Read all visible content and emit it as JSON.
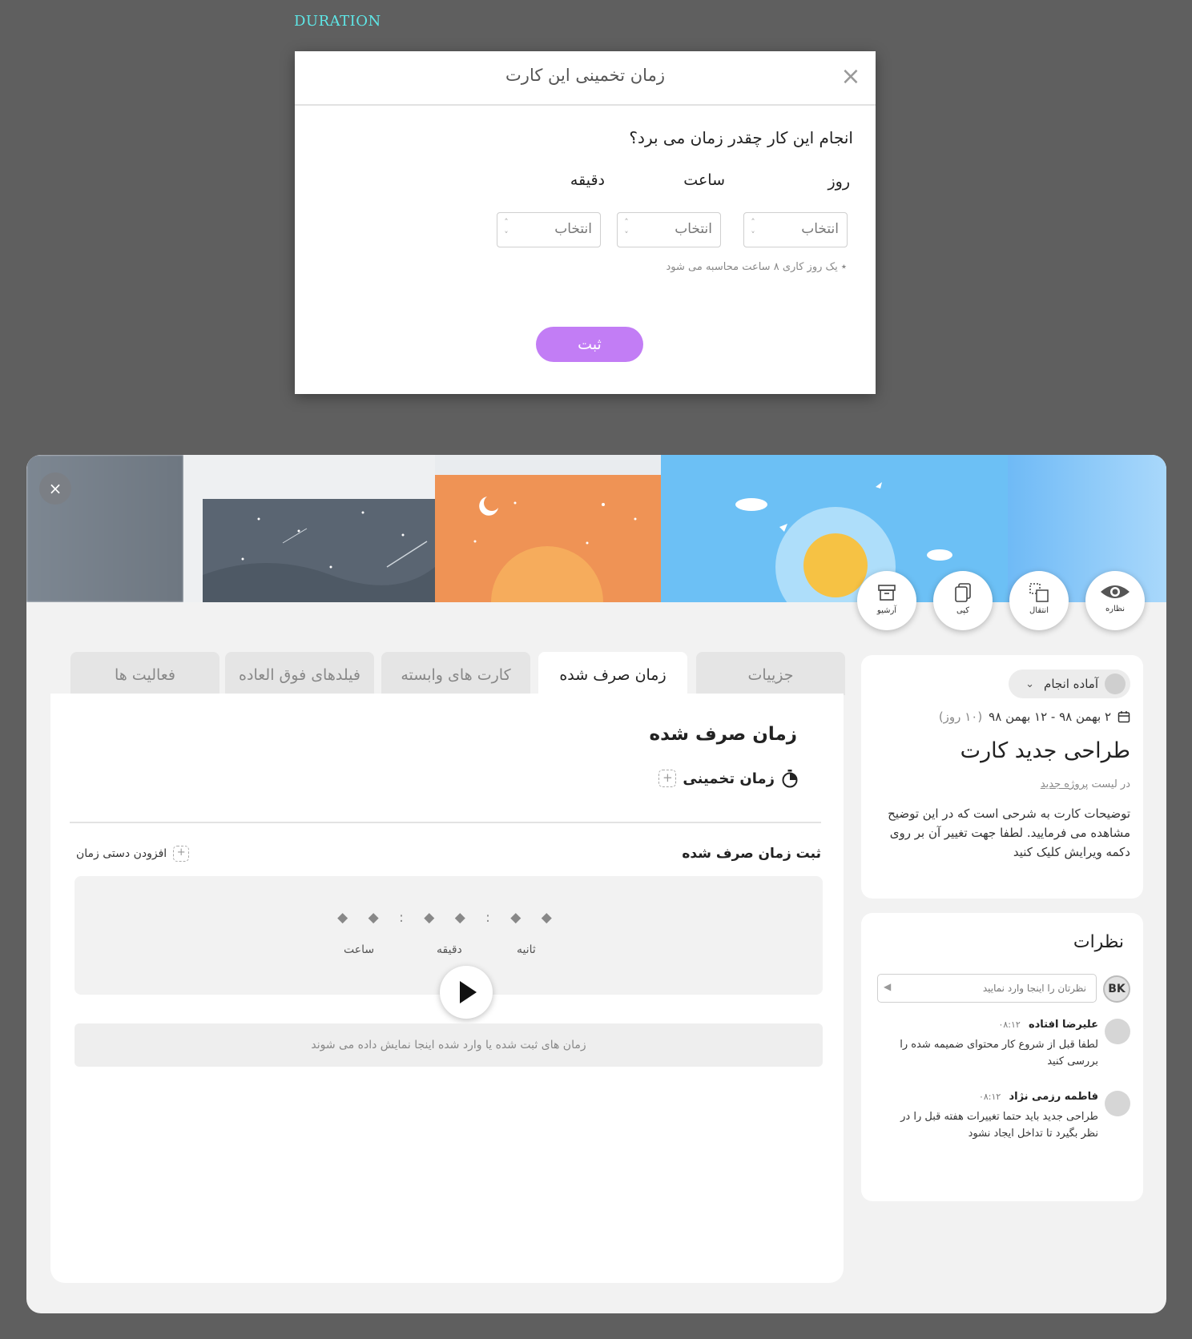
{
  "caption": "DURATION",
  "modal": {
    "title": "زمان تخمینی این کارت",
    "close_icon": "×",
    "question": "انجام این کار چقدر زمان می برد؟",
    "fields": [
      {
        "label": "روز",
        "placeholder": "انتخاب"
      },
      {
        "label": "ساعت",
        "placeholder": "انتخاب"
      },
      {
        "label": "دقیقه",
        "placeholder": "انتخاب"
      }
    ],
    "note": "٭ یک روز کاری ۸ ساعت محاسبه می شود",
    "submit_label": "ثبت",
    "accent_color": "#c27df5"
  },
  "card": {
    "close_icon": "×",
    "actions": [
      {
        "icon": "eye-icon",
        "label": "نظاره"
      },
      {
        "icon": "move-icon",
        "label": "انتقال"
      },
      {
        "icon": "copy-icon",
        "label": "کپی"
      },
      {
        "icon": "archive-icon",
        "label": "آرشیو"
      }
    ],
    "tabs": [
      {
        "label": "جزییات",
        "active": false
      },
      {
        "label": "زمان صرف شده",
        "active": true
      },
      {
        "label": "کارت های وابسته",
        "active": false
      },
      {
        "label": "فیلدهای فوق العاده",
        "active": false
      },
      {
        "label": "فعالیت ها",
        "active": false
      }
    ],
    "time_spent": {
      "title": "زمان صرف شده",
      "estimate_label": "زمان تخمینی",
      "log_title": "ثبت زمان صرف شده",
      "manual_add_label": "افزودن دستی زمان",
      "timer_display": "◆ ◆ : ◆ ◆ : ◆ ◆",
      "unit_labels": {
        "hours": "ساعت",
        "minutes": "دقیقه",
        "seconds": "ثانیه"
      },
      "empty_logs_text": "زمان های ثبت شده یا وارد شده اینجا نمایش داده می شوند"
    },
    "details": {
      "status": "آماده انجام",
      "date_range": "۲ بهمن ۹۸ - ۱۲ بهمن ۹۸",
      "days_count": "(۱۰ روز)",
      "title": "طراحی جدید کارت",
      "list_prefix": "در لیست",
      "list_name": "پروژه جدید",
      "description": "توضیحات کارت به شرحی است که در این توضیح مشاهده می فرمایید. لطفا جهت تغییر آن بر روی دکمه ویرایش کلیک کنید"
    },
    "comments": {
      "title": "نظرات",
      "user_initials": "BK",
      "input_placeholder": "نظرتان را اینجا وارد نمایید",
      "items": [
        {
          "author": "علیرضا افتاده",
          "time": "۰۸:۱۲",
          "text": "لطفا قبل از شروع کار محتوای ضمیمه شده را بررسی کنید"
        },
        {
          "author": "فاطمه رزمی نژاد",
          "time": "۰۸:۱۲",
          "text": "طراحی جدید باید حتما تغییرات هفته قبل را در نظر بگیرد تا تداخل ایجاد نشود"
        }
      ]
    }
  }
}
